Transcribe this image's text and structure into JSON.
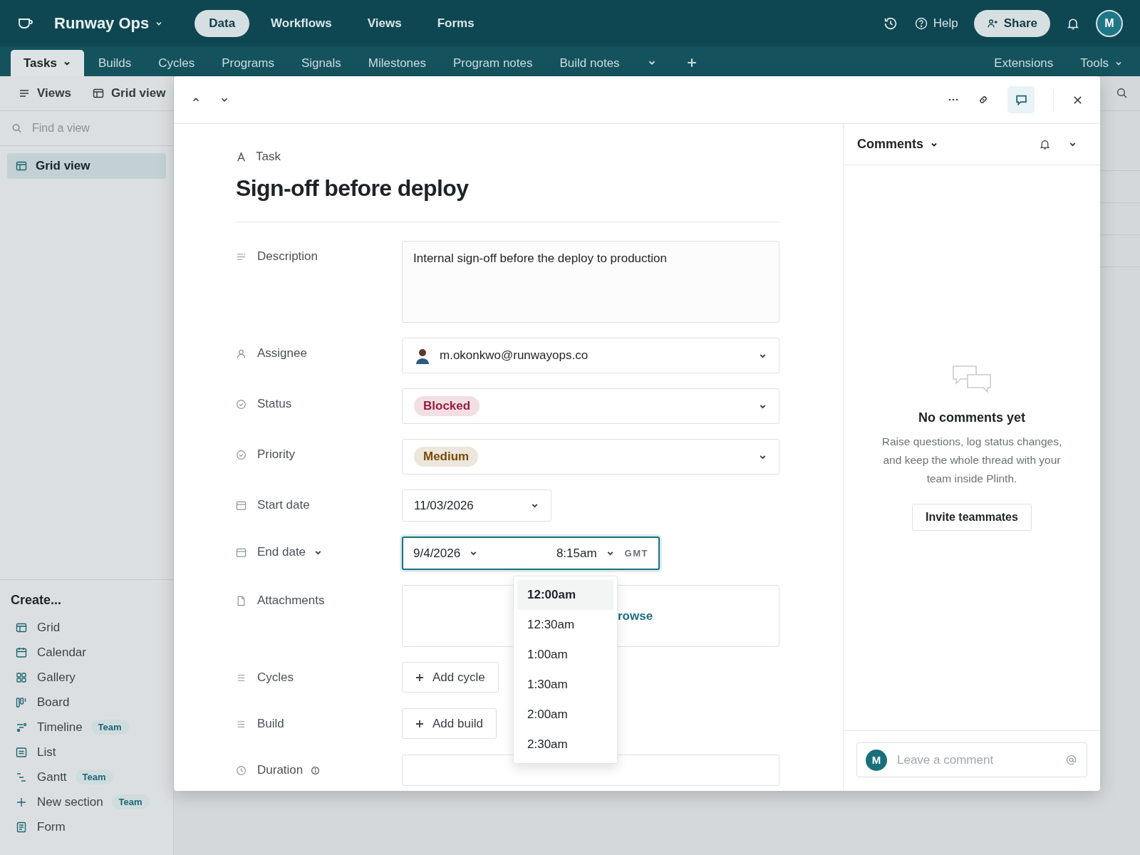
{
  "app": {
    "name": "Runway Ops",
    "help": "Help",
    "share": "Share",
    "avatar": "M"
  },
  "nav": [
    {
      "label": "Data",
      "selected": true
    },
    {
      "label": "Workflows",
      "selected": false
    },
    {
      "label": "Views",
      "selected": false
    },
    {
      "label": "Forms",
      "selected": false
    }
  ],
  "tabs": [
    {
      "label": "Tasks",
      "selected": true
    },
    {
      "label": "Builds",
      "selected": false
    },
    {
      "label": "Cycles",
      "selected": false
    },
    {
      "label": "Programs",
      "selected": false
    },
    {
      "label": "Signals",
      "selected": false
    },
    {
      "label": "Milestones",
      "selected": false
    },
    {
      "label": "Program notes",
      "selected": false
    },
    {
      "label": "Build notes",
      "selected": false
    }
  ],
  "tabs_right": {
    "extensions": "Extensions",
    "tools": "Tools"
  },
  "sidebar": {
    "views_button": "Views",
    "current_view": "Grid view",
    "search": {
      "placeholder": "Find a view"
    },
    "views": [
      {
        "label": "Grid view",
        "selected": true
      }
    ],
    "create_title": "Create...",
    "create_items": [
      {
        "label": "Grid",
        "kind": "grid"
      },
      {
        "label": "Calendar",
        "kind": "calendar"
      },
      {
        "label": "Gallery",
        "kind": "gallery"
      },
      {
        "label": "Board",
        "kind": "board"
      },
      {
        "label": "Timeline",
        "kind": "timeline",
        "badge": "Team"
      },
      {
        "label": "List",
        "kind": "list"
      },
      {
        "label": "Gantt",
        "kind": "gantt",
        "badge": "Team"
      },
      {
        "label": "New section",
        "kind": "section",
        "badge": "Team"
      },
      {
        "label": "Form",
        "kind": "form"
      }
    ]
  },
  "record": {
    "type_label": "Task",
    "title": "Sign-off before deploy",
    "fields": [
      {
        "label": "Description",
        "kind": "longtext",
        "value": "Internal sign-off before the deploy to production"
      },
      {
        "label": "Assignee",
        "kind": "user",
        "value": "m.okonkwo@runwayops.co"
      },
      {
        "label": "Status",
        "kind": "select",
        "value": "Blocked",
        "color": "#9b1c3c"
      },
      {
        "label": "Priority",
        "kind": "select",
        "value": "Medium",
        "color": "#7a4a06"
      },
      {
        "label": "Start date",
        "kind": "date",
        "value": "11/03/2026"
      },
      {
        "label": "End date",
        "kind": "datetime",
        "date": "9/4/2026",
        "time": "8:15am",
        "zone": "GMT",
        "time_options": [
          {
            "label": "12:00am",
            "selected": true
          },
          {
            "label": "12:30am",
            "selected": false
          },
          {
            "label": "1:00am",
            "selected": false
          },
          {
            "label": "1:30am",
            "selected": false
          },
          {
            "label": "2:00am",
            "selected": false
          },
          {
            "label": "2:30am",
            "selected": false
          }
        ]
      },
      {
        "label": "Attachments",
        "kind": "attachment",
        "link": "rowse"
      },
      {
        "label": "Cycles",
        "kind": "link",
        "button": "Add cycle"
      },
      {
        "label": "Build",
        "kind": "link",
        "button": "Add build"
      },
      {
        "label": "Duration",
        "kind": "number"
      }
    ]
  },
  "comments": {
    "title": "Comments",
    "empty_title": "No comments yet",
    "empty_text": "Raise questions, log status changes, and keep the whole thread with your team inside Plinth.",
    "invite": "Invite teammates",
    "composer": {
      "avatar": "M",
      "placeholder": "Leave a comment"
    }
  }
}
